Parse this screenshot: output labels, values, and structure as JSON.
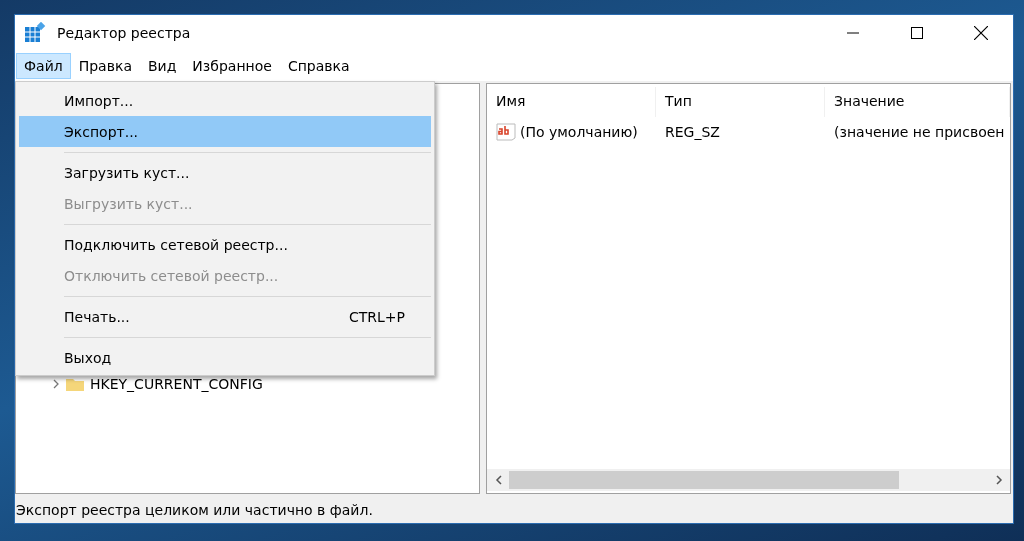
{
  "window": {
    "title": "Редактор реестра"
  },
  "menubar": [
    {
      "label": "Файл",
      "selected": true
    },
    {
      "label": "Правка",
      "selected": false
    },
    {
      "label": "Вид",
      "selected": false
    },
    {
      "label": "Избранное",
      "selected": false
    },
    {
      "label": "Справка",
      "selected": false
    }
  ],
  "file_menu": [
    {
      "kind": "item",
      "label": "Импорт...",
      "selected": false,
      "disabled": false
    },
    {
      "kind": "item",
      "label": "Экспорт...",
      "selected": true,
      "disabled": false
    },
    {
      "kind": "separator"
    },
    {
      "kind": "item",
      "label": "Загрузить куст...",
      "selected": false,
      "disabled": false
    },
    {
      "kind": "item",
      "label": "Выгрузить куст...",
      "selected": false,
      "disabled": true
    },
    {
      "kind": "separator"
    },
    {
      "kind": "item",
      "label": "Подключить сетевой реестр...",
      "selected": false,
      "disabled": false
    },
    {
      "kind": "item",
      "label": "Отключить сетевой реестр...",
      "selected": false,
      "disabled": true
    },
    {
      "kind": "separator"
    },
    {
      "kind": "item",
      "label": "Печать...",
      "shortcut": "CTRL+P",
      "selected": false,
      "disabled": false
    },
    {
      "kind": "separator"
    },
    {
      "kind": "item",
      "label": "Выход",
      "selected": false,
      "disabled": false
    }
  ],
  "tree": {
    "items": [
      {
        "label": "HKEY_CURRENT_CONFIG",
        "expanded": false
      }
    ]
  },
  "table": {
    "columns": [
      "Имя",
      "Тип",
      "Значение"
    ],
    "rows": [
      {
        "name": "(По умолчанию)",
        "type": "REG_SZ",
        "value": "(значение не присвоен"
      }
    ]
  },
  "status_bar": "Экспорт реестра целиком или частично в файл."
}
